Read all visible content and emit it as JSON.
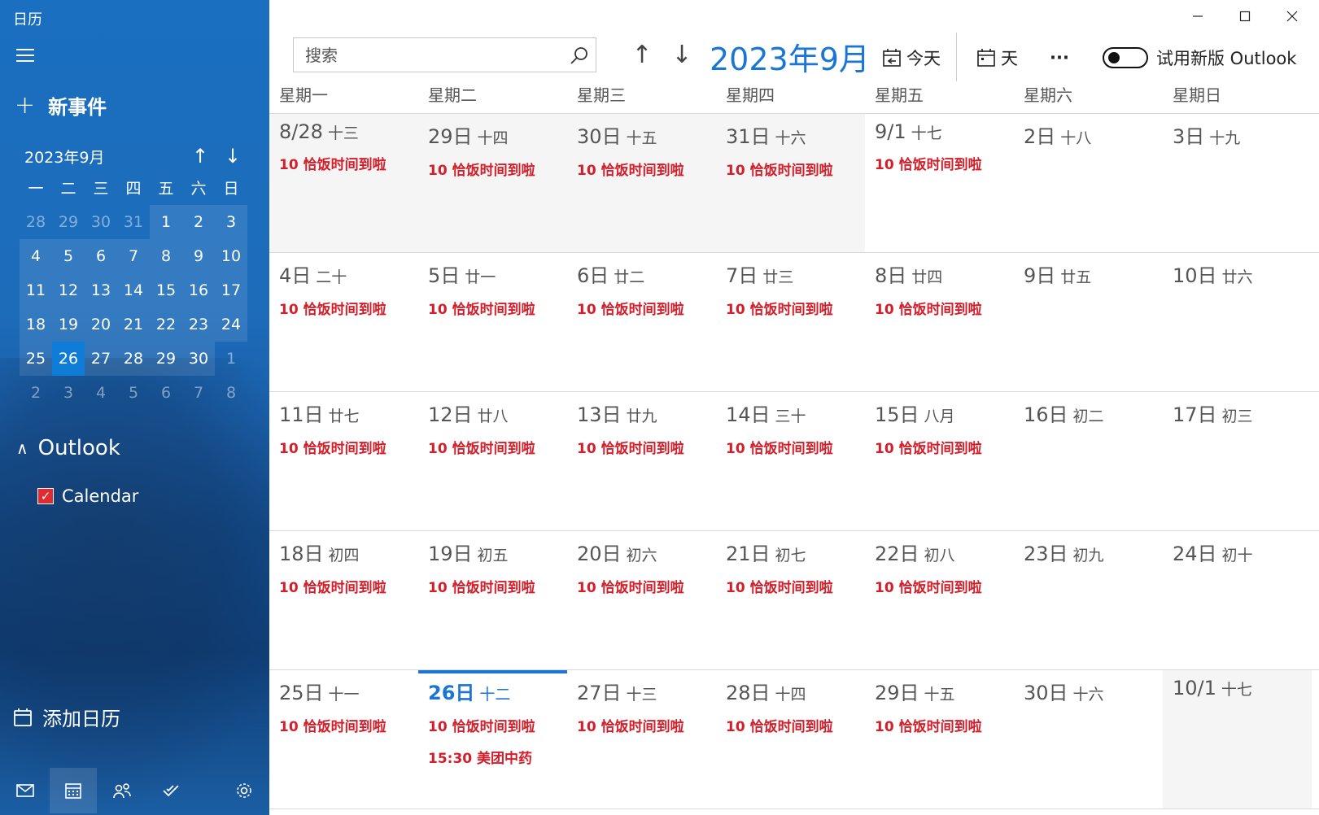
{
  "app": {
    "title": "日历"
  },
  "sidebar": {
    "new_event_label": "新事件",
    "mini_calendar": {
      "month_label": "2023年9月",
      "weekday_headers": [
        "一",
        "二",
        "三",
        "四",
        "五",
        "六",
        "日"
      ],
      "weeks": [
        [
          "28",
          "29",
          "30",
          "31",
          "1",
          "2",
          "3"
        ],
        [
          "4",
          "5",
          "6",
          "7",
          "8",
          "9",
          "10"
        ],
        [
          "11",
          "12",
          "13",
          "14",
          "15",
          "16",
          "17"
        ],
        [
          "18",
          "19",
          "20",
          "21",
          "22",
          "23",
          "24"
        ],
        [
          "25",
          "26",
          "27",
          "28",
          "29",
          "30",
          "1"
        ],
        [
          "2",
          "3",
          "4",
          "5",
          "6",
          "7",
          "8"
        ]
      ],
      "selected_day": "26"
    },
    "account_group": "Outlook",
    "calendars": [
      {
        "name": "Calendar",
        "checked": true,
        "color": "#e02b30"
      }
    ],
    "add_calendar_label": "添加日历",
    "bottom_nav": [
      {
        "icon": "mail-icon"
      },
      {
        "icon": "calendar-icon",
        "active": true
      },
      {
        "icon": "people-icon"
      },
      {
        "icon": "todo-icon"
      },
      {
        "icon": "settings-icon"
      }
    ]
  },
  "toolbar": {
    "search_placeholder": "搜索",
    "month_title": "2023年9月",
    "today_label": "今天",
    "view_label": "天",
    "more_label": "···",
    "new_outlook_label": "试用新版 Outlook"
  },
  "colors": {
    "accent": "#1a76d2",
    "event": "#d41e2a",
    "sidebar": "#1a6fc0"
  },
  "grid": {
    "weekday_headers": [
      "星期一",
      "星期二",
      "星期三",
      "星期四",
      "星期五",
      "星期六",
      "星期日"
    ],
    "weeks": [
      [
        {
          "date": "8/28",
          "lunar": "十三",
          "events": [
            "10 恰饭时间到啦"
          ],
          "outside": true
        },
        {
          "date": "29日",
          "lunar": "十四",
          "events": [
            "10 恰饭时间到啦"
          ],
          "outside": true
        },
        {
          "date": "30日",
          "lunar": "十五",
          "events": [
            "10 恰饭时间到啦"
          ],
          "outside": true
        },
        {
          "date": "31日",
          "lunar": "十六",
          "events": [
            "10 恰饭时间到啦"
          ],
          "outside": true
        },
        {
          "date": "9/1",
          "lunar": "十七",
          "events": [
            "10 恰饭时间到啦"
          ]
        },
        {
          "date": "2日",
          "lunar": "十八",
          "events": []
        },
        {
          "date": "3日",
          "lunar": "十九",
          "events": []
        }
      ],
      [
        {
          "date": "4日",
          "lunar": "二十",
          "events": [
            "10 恰饭时间到啦"
          ]
        },
        {
          "date": "5日",
          "lunar": "廿一",
          "events": [
            "10 恰饭时间到啦"
          ]
        },
        {
          "date": "6日",
          "lunar": "廿二",
          "events": [
            "10 恰饭时间到啦"
          ]
        },
        {
          "date": "7日",
          "lunar": "廿三",
          "events": [
            "10 恰饭时间到啦"
          ]
        },
        {
          "date": "8日",
          "lunar": "廿四",
          "events": [
            "10 恰饭时间到啦"
          ]
        },
        {
          "date": "9日",
          "lunar": "廿五",
          "events": []
        },
        {
          "date": "10日",
          "lunar": "廿六",
          "events": []
        }
      ],
      [
        {
          "date": "11日",
          "lunar": "廿七",
          "events": [
            "10 恰饭时间到啦"
          ]
        },
        {
          "date": "12日",
          "lunar": "廿八",
          "events": [
            "10 恰饭时间到啦"
          ]
        },
        {
          "date": "13日",
          "lunar": "廿九",
          "events": [
            "10 恰饭时间到啦"
          ]
        },
        {
          "date": "14日",
          "lunar": "三十",
          "events": [
            "10 恰饭时间到啦"
          ]
        },
        {
          "date": "15日",
          "lunar": "八月",
          "events": [
            "10 恰饭时间到啦"
          ]
        },
        {
          "date": "16日",
          "lunar": "初二",
          "events": []
        },
        {
          "date": "17日",
          "lunar": "初三",
          "events": []
        }
      ],
      [
        {
          "date": "18日",
          "lunar": "初四",
          "events": [
            "10 恰饭时间到啦"
          ]
        },
        {
          "date": "19日",
          "lunar": "初五",
          "events": [
            "10 恰饭时间到啦"
          ]
        },
        {
          "date": "20日",
          "lunar": "初六",
          "events": [
            "10 恰饭时间到啦"
          ]
        },
        {
          "date": "21日",
          "lunar": "初七",
          "events": [
            "10 恰饭时间到啦"
          ]
        },
        {
          "date": "22日",
          "lunar": "初八",
          "events": [
            "10 恰饭时间到啦"
          ]
        },
        {
          "date": "23日",
          "lunar": "初九",
          "events": []
        },
        {
          "date": "24日",
          "lunar": "初十",
          "events": []
        }
      ],
      [
        {
          "date": "25日",
          "lunar": "十一",
          "events": [
            "10 恰饭时间到啦"
          ]
        },
        {
          "date": "26日",
          "lunar": "十二",
          "events": [
            "10 恰饭时间到啦",
            "15:30 美团中药"
          ],
          "today": true
        },
        {
          "date": "27日",
          "lunar": "十三",
          "events": [
            "10 恰饭时间到啦"
          ]
        },
        {
          "date": "28日",
          "lunar": "十四",
          "events": [
            "10 恰饭时间到啦"
          ]
        },
        {
          "date": "29日",
          "lunar": "十五",
          "events": [
            "10 恰饭时间到啦"
          ]
        },
        {
          "date": "30日",
          "lunar": "十六",
          "events": []
        },
        {
          "date": "10/1",
          "lunar": "十七",
          "events": [],
          "outside": true
        }
      ]
    ]
  }
}
